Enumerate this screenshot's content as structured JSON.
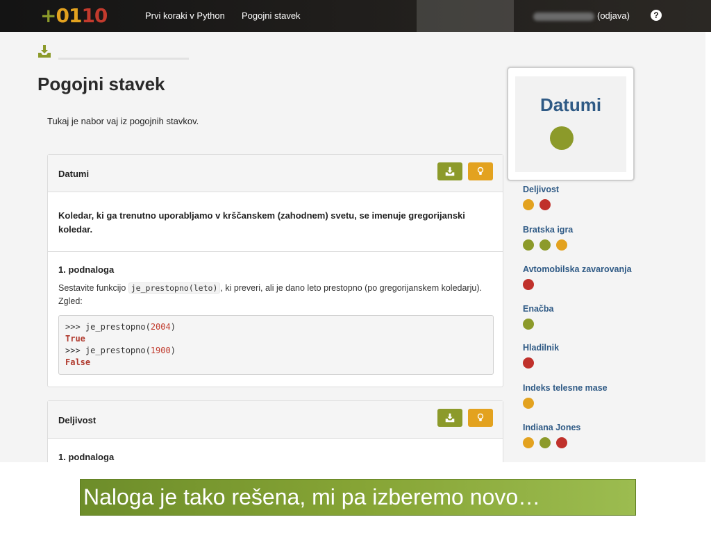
{
  "navbar": {
    "logo_plus": "+",
    "logo_a": "01",
    "logo_b": "10",
    "course_link": "Prvi koraki v Python",
    "section_link": "Pogojni stavek",
    "logout_label": "(odjava)",
    "help_glyph": "?"
  },
  "page": {
    "title": "Pogojni stavek",
    "intro": "Tukaj je nabor vaj iz pogojnih stavkov."
  },
  "problems": [
    {
      "title": "Datumi",
      "description": "Koledar, ki ga trenutno uporabljamo v krščanskem (zahodnem) svetu, se imenuje gregorijanski koledar.",
      "subtask": {
        "title": "1. podnaloga",
        "text_before": "Sestavite funkcijo ",
        "code": "je_prestopno(leto)",
        "text_after": ", ki preveri, ali je dano leto prestopno (po gregorijanskem koledarju). Zgled:",
        "example": {
          "line1_prompt": ">>> je_prestopno(",
          "line1_arg": "2004",
          "line1_end": ")",
          "line2": "True",
          "line3_prompt": ">>> je_prestopno(",
          "line3_arg": "1900",
          "line3_end": ")",
          "line4": "False"
        }
      }
    },
    {
      "title": "Deljivost",
      "subtask_title": "1. podnaloga"
    }
  ],
  "sidebar": {
    "current": {
      "title": "Datumi",
      "status": "green"
    },
    "items": [
      {
        "name": "Deljivost",
        "dots": [
          "yellow",
          "red"
        ]
      },
      {
        "name": "Bratska igra",
        "dots": [
          "green",
          "green",
          "yellow"
        ]
      },
      {
        "name": "Avtomobilska zavarovanja",
        "dots": [
          "red"
        ]
      },
      {
        "name": "Enačba",
        "dots": [
          "green"
        ]
      },
      {
        "name": "Hladilnik",
        "dots": [
          "red"
        ]
      },
      {
        "name": "Indeks telesne mase",
        "dots": [
          "yellow"
        ]
      },
      {
        "name": "Indiana Jones",
        "dots": [
          "yellow",
          "green",
          "red"
        ]
      }
    ]
  },
  "colors": {
    "green": "#8c9a2a",
    "yellow": "#e3a21f",
    "red": "#c0312b",
    "link_blue": "#2f5a85"
  },
  "icons": {
    "download": "download-icon",
    "hint": "lightbulb-icon",
    "help": "help-icon"
  },
  "caption": {
    "text": "Naloga je tako rešena, mi pa izberemo novo…"
  }
}
